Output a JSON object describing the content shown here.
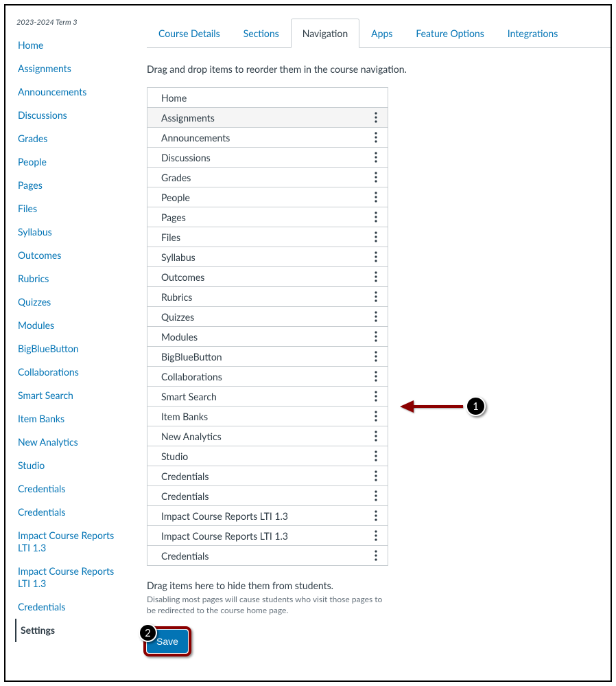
{
  "term": "2023-2024 Term 3",
  "sidebar": {
    "items": [
      {
        "label": "Home"
      },
      {
        "label": "Assignments"
      },
      {
        "label": "Announcements"
      },
      {
        "label": "Discussions"
      },
      {
        "label": "Grades"
      },
      {
        "label": "People"
      },
      {
        "label": "Pages"
      },
      {
        "label": "Files"
      },
      {
        "label": "Syllabus"
      },
      {
        "label": "Outcomes"
      },
      {
        "label": "Rubrics"
      },
      {
        "label": "Quizzes"
      },
      {
        "label": "Modules"
      },
      {
        "label": "BigBlueButton"
      },
      {
        "label": "Collaborations"
      },
      {
        "label": "Smart Search"
      },
      {
        "label": "Item Banks"
      },
      {
        "label": "New Analytics"
      },
      {
        "label": "Studio"
      },
      {
        "label": "Credentials"
      },
      {
        "label": "Credentials"
      },
      {
        "label": "Impact Course Reports LTI 1.3"
      },
      {
        "label": "Impact Course Reports LTI 1.3"
      },
      {
        "label": "Credentials"
      }
    ],
    "active": "Settings"
  },
  "tabs": [
    {
      "label": "Course Details"
    },
    {
      "label": "Sections"
    },
    {
      "label": "Navigation"
    },
    {
      "label": "Apps"
    },
    {
      "label": "Feature Options"
    },
    {
      "label": "Integrations"
    }
  ],
  "instructions": "Drag and drop items to reorder them in the course navigation.",
  "nav_items": [
    {
      "label": "Home",
      "no_menu": true
    },
    {
      "label": "Assignments",
      "highlight": true
    },
    {
      "label": "Announcements"
    },
    {
      "label": "Discussions"
    },
    {
      "label": "Grades"
    },
    {
      "label": "People"
    },
    {
      "label": "Pages"
    },
    {
      "label": "Files"
    },
    {
      "label": "Syllabus"
    },
    {
      "label": "Outcomes"
    },
    {
      "label": "Rubrics"
    },
    {
      "label": "Quizzes"
    },
    {
      "label": "Modules"
    },
    {
      "label": "BigBlueButton"
    },
    {
      "label": "Collaborations"
    },
    {
      "label": "Smart Search"
    },
    {
      "label": "Item Banks"
    },
    {
      "label": "New Analytics"
    },
    {
      "label": "Studio"
    },
    {
      "label": "Credentials"
    },
    {
      "label": "Credentials"
    },
    {
      "label": "Impact Course Reports LTI 1.3"
    },
    {
      "label": "Impact Course Reports LTI 1.3"
    },
    {
      "label": "Credentials"
    }
  ],
  "hide_title": "Drag items here to hide them from students.",
  "hide_sub": "Disabling most pages will cause students who visit those pages to be redirected to the course home page.",
  "save_label": "Save",
  "callouts": {
    "one": "1",
    "two": "2"
  }
}
